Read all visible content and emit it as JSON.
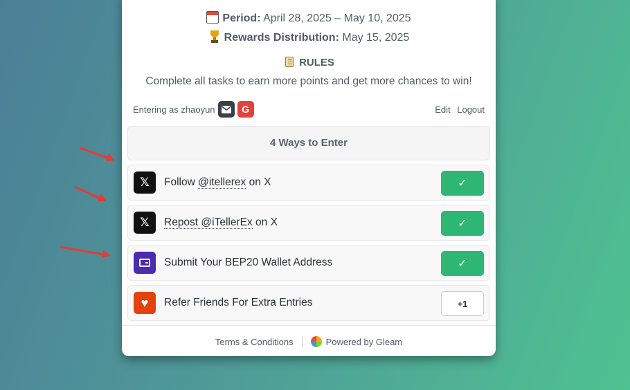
{
  "period": {
    "label": "Period:",
    "value": "April 28, 2025 – May 10, 2025"
  },
  "rewards": {
    "label": "Rewards Distribution:",
    "value": "May 15, 2025"
  },
  "rules": {
    "title": "RULES",
    "text": "Complete all tasks to earn more points and get more chances to win!"
  },
  "user": {
    "entering_text": "Entering as zhaoyun",
    "google_letter": "G",
    "edit_label": "Edit",
    "logout_label": "Logout"
  },
  "ways_header": "4 Ways to Enter",
  "entries": [
    {
      "prefix": "Follow ",
      "handle": "@itellerex",
      "suffix": " on X",
      "icon": "x-logo-icon",
      "status": "completed"
    },
    {
      "prefix": "",
      "handle": "Repost @iTellerEx",
      "suffix": " on X",
      "icon": "x-logo-icon",
      "status": "completed"
    },
    {
      "prefix": "Submit Your BEP20 Wallet Address",
      "handle": "",
      "suffix": "",
      "icon": "wallet-icon",
      "status": "completed"
    },
    {
      "prefix": "Refer Friends For Extra Entries",
      "handle": "",
      "suffix": "",
      "icon": "heart-icon",
      "status": "+1"
    }
  ],
  "footer": {
    "terms_label": "Terms & Conditions",
    "powered_label": "Powered by Gleam"
  },
  "colors": {
    "check_button": "#2eb674",
    "x_icon_bg": "#111111",
    "wallet_icon_bg": "#4b2bb0",
    "heart_icon_bg": "#e3410d",
    "annotation_arrow": "#e43b34"
  }
}
